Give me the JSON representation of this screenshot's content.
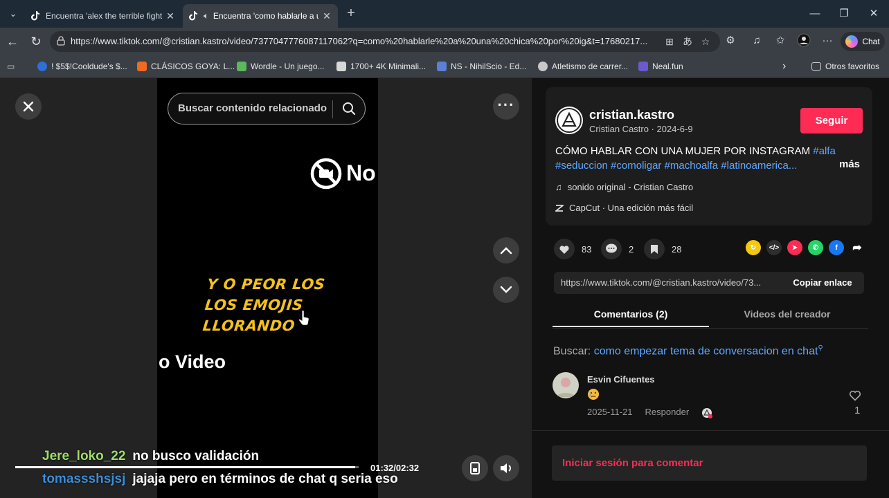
{
  "browser": {
    "tabs": [
      {
        "title": "Encuentra 'alex the terrible fight' en TikTok",
        "active": false
      },
      {
        "title": "Encuentra 'como hablarle a una chica por ig' en TikTok",
        "active": true
      }
    ],
    "url": "https://www.tiktok.com/@cristian.kastro/video/7377047776087117062?q=como%20hablarle%20a%20una%20chica%20por%20ig&t=17680217...",
    "chat_label": "Chat",
    "bookmarks": [
      {
        "label": "! $5$!Cooldude's $...",
        "color": "#2f6fd6"
      },
      {
        "label": "CLÁSICOS GOYA: L...",
        "color": "#f06a21"
      },
      {
        "label": "Wordle - Un juego...",
        "color": "#5cb85c"
      },
      {
        "label": "1700+ 4K Minimali...",
        "color": "#d8d8d8"
      },
      {
        "label": "NS - NihilScio - Ed...",
        "color": "#5d7fd6"
      },
      {
        "label": "Atletismo de carrer...",
        "color": "#c8c8c8"
      },
      {
        "label": "Neal.fun",
        "color": "#6a5acd"
      }
    ],
    "other_favorites": "Otros favoritos"
  },
  "player": {
    "search_placeholder": "Buscar contenido relacionado",
    "overlay_top": "No",
    "caption": "Y O PEOR LOS LOS EMOJIS LLORANDO",
    "overlay_bottom": "o Video",
    "timecode": "01:32/02:32",
    "progress": 0.99
  },
  "chat_overlay": [
    {
      "user": "Jere_loko_22",
      "message": "no busco validación"
    },
    {
      "user": "tomassshsjsj",
      "message": "jajaja pero en términos de chat q seria eso"
    }
  ],
  "post": {
    "username": "cristian.kastro",
    "display_name_date": "Cristian Castro · 2024-6-9",
    "follow_label": "Seguir",
    "description": "CÓMO HABLAR CON UNA MUJER POR INSTAGRAM ",
    "tags": "#alfa #seduccion #comoligar #machoalfa #latinoamerica...",
    "more_label": "más",
    "sound": "sonido original - Cristian Castro",
    "capcut": "CapCut · Una edición más fácil",
    "likes": "83",
    "comments": "2",
    "saves": "28",
    "link": "https://www.tiktok.com/@cristian.kastro/video/73...",
    "copy_label": "Copiar enlace"
  },
  "tabs": {
    "comments": "Comentarios (2)",
    "creator_videos": "Videos del creador"
  },
  "related_search": {
    "label": "Buscar: ",
    "query": "como empezar tema de conversacion en chat"
  },
  "comment": {
    "author": "Esvin Cifuentes",
    "date": "2025-11-21",
    "reply_label": "Responder",
    "likes": "1"
  },
  "login_label": "Iniciar sesión para comentar",
  "colors": {
    "accent": "#fe2c55",
    "link": "#5fa7ff",
    "caption": "#f4c21b"
  }
}
